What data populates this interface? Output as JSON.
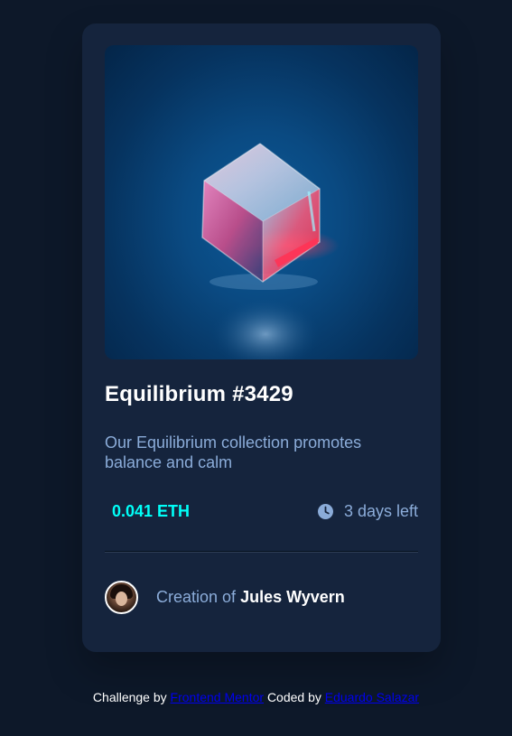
{
  "card": {
    "image_name": "equilibrium-cube-image",
    "title": "Equilibrium #3429",
    "description": "Our Equilibrium collection promotes balance and calm",
    "price": "0.041 ETH",
    "time_left": "3 days left",
    "creator_prefix": "Creation of",
    "creator_name": "Jules Wyvern"
  },
  "attribution": {
    "challenge_prefix": "Challenge by",
    "challenge_link": "Frontend Mentor",
    "coded_prefix": "Coded by",
    "coded_link": "Eduardo Salazar"
  },
  "colors": {
    "background": "#0d1829",
    "card": "#15243d",
    "accent_cyan": "#00fff8",
    "soft_blue": "#8bacd9",
    "white": "#ffffff"
  },
  "icons": {
    "clock": "clock-icon"
  }
}
